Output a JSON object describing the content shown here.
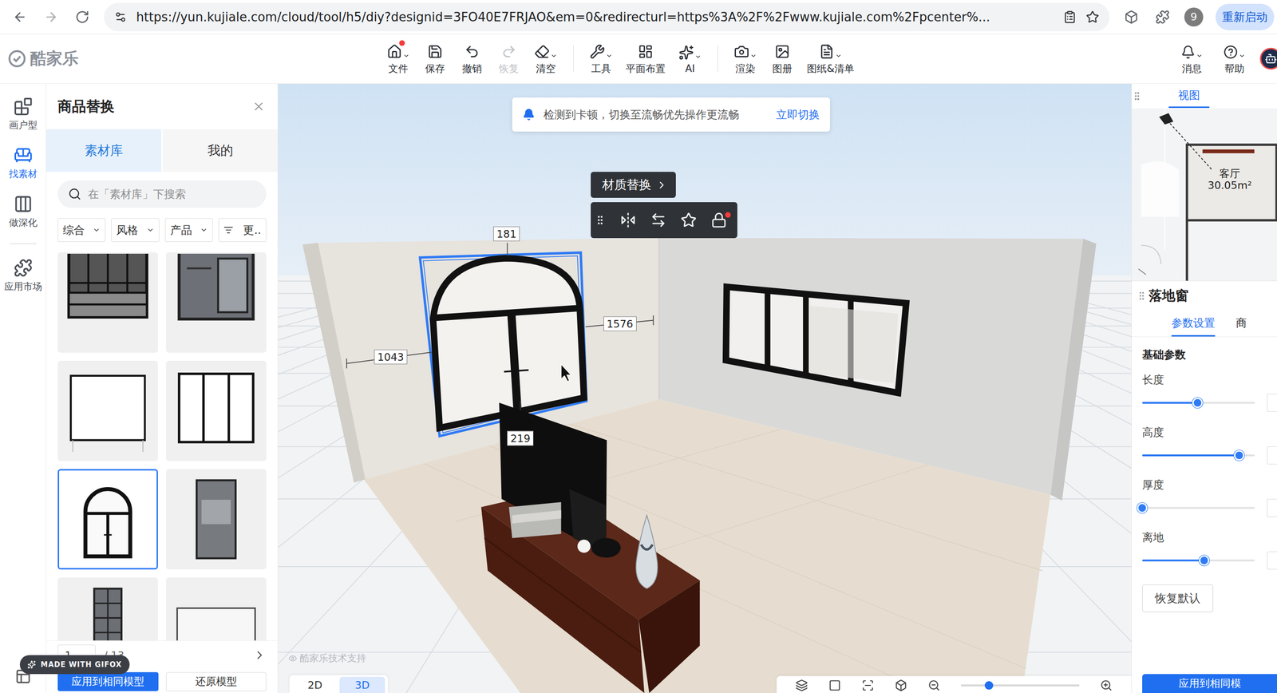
{
  "browser": {
    "url": "https://yun.kujiale.com/cloud/tool/h5/diy?designid=3FO40E7FRJAO&em=0&redirecturl=https%3A%2F%2Fwww.kujiale.com%2Fpcenter%...",
    "profile": "9",
    "restart": "重新启动"
  },
  "app": {
    "logo": "酷家乐",
    "toolbar": [
      {
        "label": "文件",
        "dropdown": true,
        "disabled": false,
        "badge": true,
        "divider_before": false
      },
      {
        "label": "保存",
        "dropdown": false,
        "disabled": false,
        "badge": false,
        "divider_before": false
      },
      {
        "label": "撤销",
        "dropdown": false,
        "disabled": false,
        "badge": false,
        "divider_before": false
      },
      {
        "label": "恢复",
        "dropdown": false,
        "disabled": true,
        "badge": false,
        "divider_before": false
      },
      {
        "label": "清空",
        "dropdown": true,
        "disabled": false,
        "badge": false,
        "divider_before": false
      },
      {
        "label": "工具",
        "dropdown": true,
        "disabled": false,
        "badge": false,
        "divider_before": true
      },
      {
        "label": "平面布置",
        "dropdown": false,
        "disabled": false,
        "badge": false,
        "divider_before": false
      },
      {
        "label": "AI",
        "dropdown": true,
        "disabled": false,
        "badge": false,
        "divider_before": false
      },
      {
        "label": "渲染",
        "dropdown": true,
        "disabled": false,
        "badge": false,
        "divider_before": true
      },
      {
        "label": "图册",
        "dropdown": false,
        "disabled": false,
        "badge": false,
        "divider_before": false
      },
      {
        "label": "图纸&清单",
        "dropdown": true,
        "disabled": false,
        "badge": false,
        "divider_before": false
      }
    ],
    "right": [
      {
        "label": "消息",
        "dropdown": true
      },
      {
        "label": "帮助",
        "dropdown": true
      }
    ]
  },
  "rail": [
    {
      "label": "画户型",
      "selected": false
    },
    {
      "label": "找素材",
      "selected": true
    },
    {
      "label": "做深化",
      "selected": false
    },
    {
      "label": "应用市场",
      "selected": false
    }
  ],
  "panel": {
    "title": "商品替换",
    "tabs": [
      {
        "label": "素材库",
        "selected": true
      },
      {
        "label": "我的",
        "selected": false
      }
    ],
    "search": {
      "placeholder": "在「素材库」下搜索"
    },
    "filters": [
      {
        "label": "综合",
        "kind": "dropdown"
      },
      {
        "label": "风格",
        "kind": "dropdown"
      },
      {
        "label": "产品",
        "kind": "dropdown"
      },
      {
        "label": "更..",
        "kind": "filter"
      }
    ],
    "items": [
      {
        "kind": "grid-window",
        "selected": false
      },
      {
        "kind": "glass-door",
        "selected": false
      },
      {
        "kind": "plain-frame",
        "selected": false
      },
      {
        "kind": "triple-pane",
        "selected": false
      },
      {
        "kind": "arch-window",
        "selected": true
      },
      {
        "kind": "slim-door",
        "selected": false
      },
      {
        "kind": "tall-grid",
        "selected": false
      },
      {
        "kind": "wide-frame",
        "selected": false
      }
    ],
    "pagination": {
      "page": "1",
      "total": "/ 13"
    },
    "buttons": [
      {
        "label": "应用到相同模型",
        "primary": true
      },
      {
        "label": "还原模型",
        "primary": false
      }
    ]
  },
  "watermark": "MADE WITH GIFOX",
  "canvas": {
    "notice": {
      "text": "检测到卡顿，切换至流畅优先操作更流畅",
      "action": "立即切换"
    },
    "popup": {
      "title": "材质替换",
      "lock_badge": true
    },
    "dimensions": [
      {
        "value": "181"
      },
      {
        "value": "1576"
      },
      {
        "value": "1043"
      },
      {
        "value": "219"
      }
    ],
    "credit": "酷家乐技术支持",
    "view_modes": [
      {
        "label": "2D",
        "selected": false
      },
      {
        "label": "3D",
        "selected": true
      }
    ]
  },
  "minimap": {
    "tab": "视图",
    "room": "客厅",
    "area": "30.05m²"
  },
  "properties": {
    "title": "落地窗",
    "tabs": [
      {
        "label": "参数设置",
        "selected": true
      },
      {
        "label": "商",
        "selected": false
      }
    ],
    "section": "基础参数",
    "sliders": [
      {
        "label": "长度",
        "level": 0.49
      },
      {
        "label": "高度",
        "level": 0.86
      },
      {
        "label": "厚度",
        "level": 0
      },
      {
        "label": "离地",
        "level": 0.55
      }
    ],
    "reset": "恢复默认",
    "apply": "应用到相同模"
  }
}
